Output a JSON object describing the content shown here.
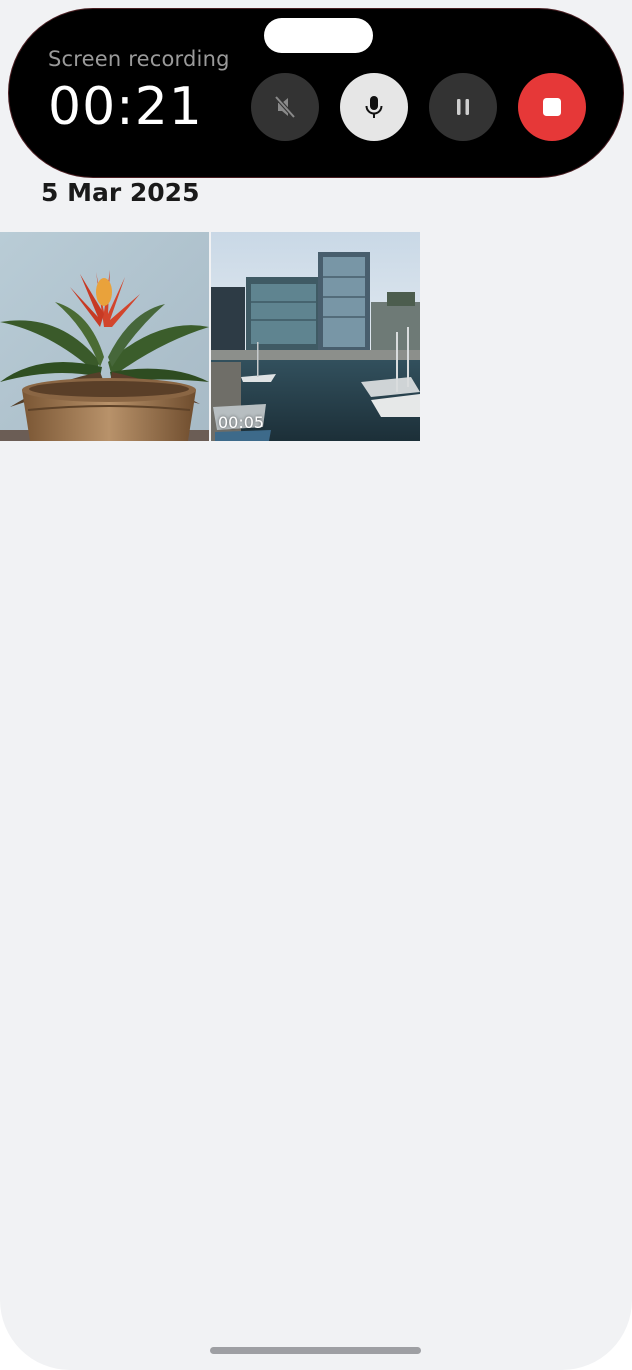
{
  "recorder": {
    "label": "Screen recording",
    "elapsed": "00:21",
    "controls": {
      "mute": "speaker-muted-icon",
      "mic": "microphone-icon",
      "pause": "pause-icon",
      "stop": "stop-icon"
    },
    "stop_color": "#e63838"
  },
  "gallery": {
    "date_header": "5 Mar 2025",
    "items": [
      {
        "type": "photo",
        "subject": "potted-bromeliad"
      },
      {
        "type": "video",
        "subject": "harbor-buildings",
        "duration": "00:05"
      }
    ]
  }
}
